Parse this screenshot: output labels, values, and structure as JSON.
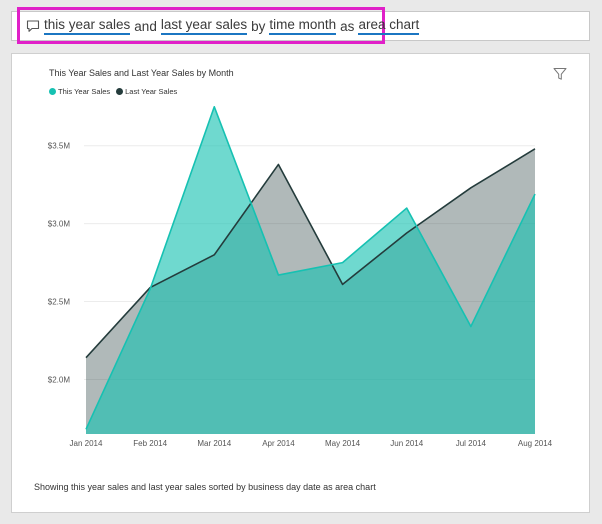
{
  "qa": {
    "icon": "comment-icon",
    "tokens": [
      {
        "text": "this year sales",
        "keyword": true
      },
      {
        "text": "and",
        "keyword": false
      },
      {
        "text": "last year sales",
        "keyword": true
      },
      {
        "text": "by",
        "keyword": false
      },
      {
        "text": "time month",
        "keyword": true
      },
      {
        "text": "as",
        "keyword": false
      },
      {
        "text": "area chart",
        "keyword": true
      }
    ]
  },
  "colors": {
    "highlight_border": "#e020c8",
    "keyword_underline": "#1b76c2",
    "this_year": "#16c1b2",
    "last_year": "#243c3c"
  },
  "filter_icon": "filter-icon",
  "footer": "Showing this year sales and last year sales sorted by business day date as area chart",
  "chart_data": {
    "type": "area",
    "title": "This Year Sales and Last Year Sales by Month",
    "xlabel": "",
    "ylabel": "",
    "categories": [
      "Jan 2014",
      "Feb 2014",
      "Mar 2014",
      "Apr 2014",
      "May 2014",
      "Jun 2014",
      "Jul 2014",
      "Aug 2014"
    ],
    "y_ticks": [
      {
        "value": 2000000,
        "label": "$2.0M"
      },
      {
        "value": 2500000,
        "label": "$2.5M"
      },
      {
        "value": 3000000,
        "label": "$3.0M"
      },
      {
        "value": 3500000,
        "label": "$3.5M"
      }
    ],
    "ylim": [
      1650000,
      3800000
    ],
    "grid": true,
    "legend": "top-left",
    "series": [
      {
        "name": "This Year Sales",
        "color": "#16c1b2",
        "values": [
          1680000,
          2580000,
          3750000,
          2670000,
          2750000,
          3100000,
          2340000,
          3190000
        ]
      },
      {
        "name": "Last Year Sales",
        "color": "#243c3c",
        "values": [
          2140000,
          2590000,
          2800000,
          3380000,
          2610000,
          2940000,
          3230000,
          3480000
        ]
      }
    ]
  }
}
